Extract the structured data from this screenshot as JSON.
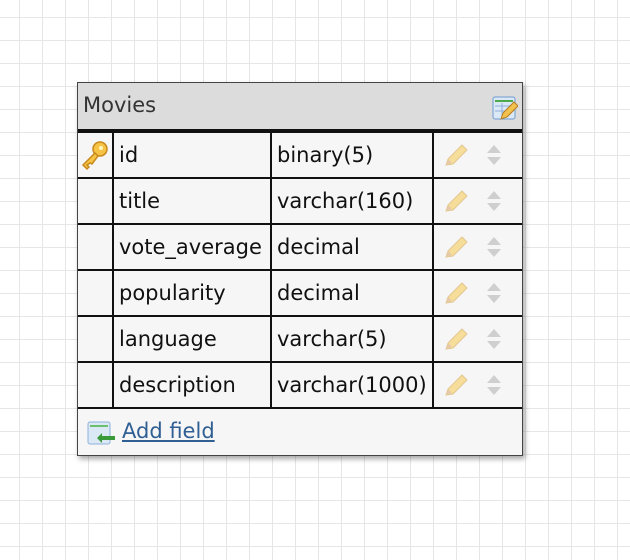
{
  "entity": {
    "title": "Movies",
    "edit_icon": "table-edit-icon",
    "fields": [
      {
        "name": "id",
        "type": "binary(5)",
        "primary_key": true
      },
      {
        "name": "title",
        "type": "varchar(160)",
        "primary_key": false
      },
      {
        "name": "vote_average",
        "type": "decimal",
        "primary_key": false
      },
      {
        "name": "popularity",
        "type": "decimal",
        "primary_key": false
      },
      {
        "name": "language",
        "type": "varchar(5)",
        "primary_key": false
      },
      {
        "name": "description",
        "type": "varchar(1000)",
        "primary_key": false
      }
    ],
    "add_field_label": "Add field",
    "colors": {
      "header_bg": "#dcdcdc",
      "link": "#2f5f93",
      "key": "#f0b830"
    }
  }
}
